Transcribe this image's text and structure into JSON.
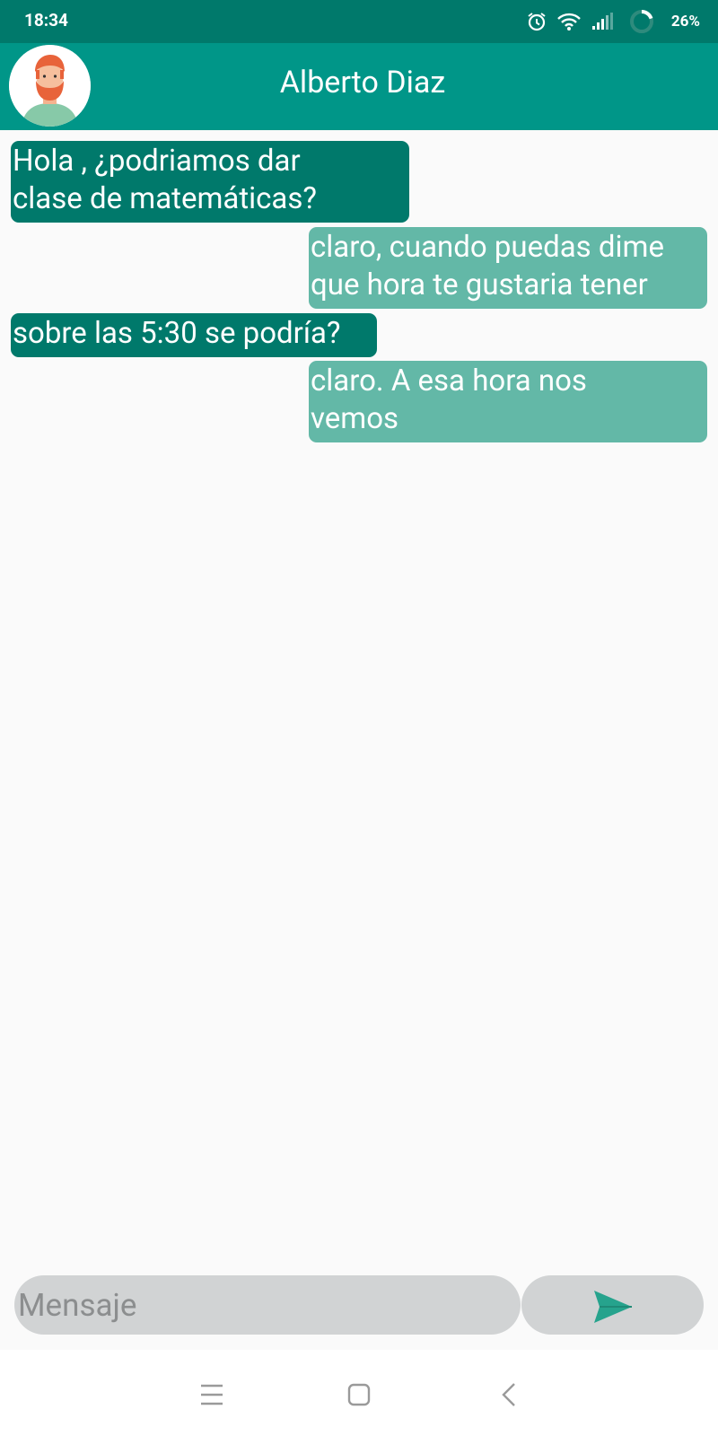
{
  "status_bar": {
    "time": "18:34",
    "battery": "26%",
    "icons": [
      "alarm-icon",
      "wifi-icon",
      "signal-icon",
      "battery-ring-icon"
    ]
  },
  "header": {
    "contact_name": "Alberto Diaz",
    "avatar_icon": "person-avatar"
  },
  "messages": [
    {
      "direction": "received",
      "text": "Hola , ¿podriamos dar\nclase de matemáticas?"
    },
    {
      "direction": "sent",
      "text": "claro, cuando puedas dime\nque hora te gustaria tener"
    },
    {
      "direction": "received",
      "text": "sobre las 5:30 se podría?"
    },
    {
      "direction": "sent",
      "text": "claro. A esa hora nos\nvemos"
    }
  ],
  "composer": {
    "placeholder": "Mensaje",
    "value": "",
    "send_icon": "send-icon"
  },
  "nav_bar": {
    "icons": [
      "menu-icon",
      "home-icon",
      "back-icon"
    ]
  },
  "colors": {
    "status_bar": "#00796b",
    "app_bar": "#009688",
    "received_bubble": "#00796b",
    "sent_bubble": "#63b8a7",
    "input_background": "#d1d3d4",
    "send_icon": "#26a38d"
  }
}
